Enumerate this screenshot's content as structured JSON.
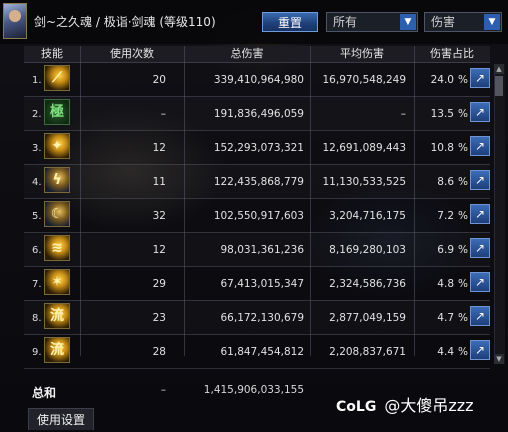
{
  "header": {
    "character_name": "剑~之久魂 / 极诣·剑魂 (等级110)",
    "reset_button": "重置",
    "owner_filter": "所有",
    "type_filter": "伤害"
  },
  "table": {
    "columns": [
      "技能",
      "使用次数",
      "总伤害",
      "平均伤害",
      "伤害占比"
    ],
    "rows": [
      {
        "rank": "1.",
        "icon": "skill-sword-slash-icon",
        "count": "20",
        "total": "339,410,964,980",
        "avg": "16,970,548,249",
        "pct": "24.0",
        "sign": "%"
      },
      {
        "rank": "2.",
        "icon": "skill-green-rune-icon",
        "count": "–",
        "total": "191,836,496,059",
        "avg": "–",
        "pct": "13.5",
        "sign": "%"
      },
      {
        "rank": "3.",
        "icon": "skill-sword-burst-icon",
        "count": "12",
        "total": "152,293,073,321",
        "avg": "12,691,089,443",
        "pct": "10.8",
        "sign": "%"
      },
      {
        "rank": "4.",
        "icon": "skill-lightning-slash-icon",
        "count": "11",
        "total": "122,435,868,779",
        "avg": "11,130,533,525",
        "pct": "8.6",
        "sign": "%"
      },
      {
        "rank": "5.",
        "icon": "skill-moon-slash-icon",
        "count": "32",
        "total": "102,550,917,603",
        "avg": "3,204,716,175",
        "pct": "7.2",
        "sign": "%"
      },
      {
        "rank": "6.",
        "icon": "skill-wave-slash-icon",
        "count": "12",
        "total": "98,031,361,236",
        "avg": "8,169,280,103",
        "pct": "6.9",
        "sign": "%"
      },
      {
        "rank": "7.",
        "icon": "skill-beast-slash-icon",
        "count": "29",
        "total": "67,413,015,347",
        "avg": "2,324,586,736",
        "pct": "4.8",
        "sign": "%"
      },
      {
        "rank": "8.",
        "icon": "skill-flow-slash-icon",
        "count": "23",
        "total": "66,172,130,679",
        "avg": "2,877,049,159",
        "pct": "4.7",
        "sign": "%"
      },
      {
        "rank": "9.",
        "icon": "skill-flow-crescent-icon",
        "count": "28",
        "total": "61,847,454,812",
        "avg": "2,208,837,671",
        "pct": "4.4",
        "sign": "%"
      }
    ]
  },
  "total": {
    "label": "总和",
    "count": "–",
    "value": "1,415,906,033,155"
  },
  "footer": {
    "settings_tab": "使用设置",
    "watermark_logo": "CoLG",
    "watermark_text": "@大傻吊zzz"
  }
}
